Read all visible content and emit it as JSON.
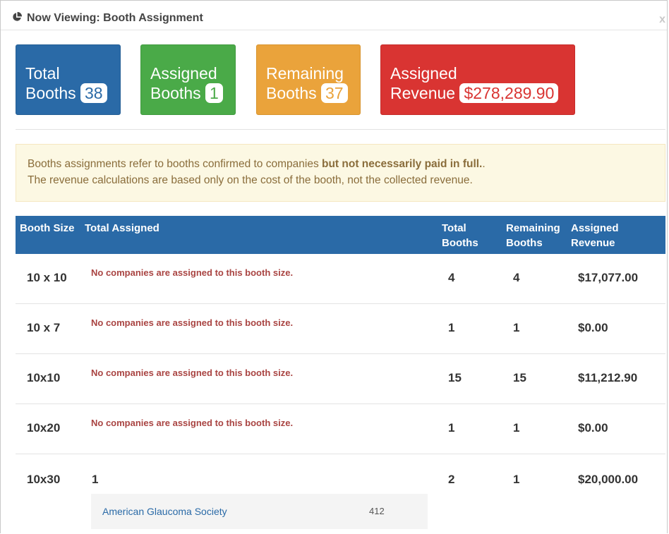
{
  "window": {
    "title": "Now Viewing: Booth Assignment",
    "close_label": "x"
  },
  "stats": {
    "total": {
      "label_line1": "Total",
      "label_line2": "Booths",
      "value": "38"
    },
    "assigned": {
      "label_line1": "Assigned",
      "label_line2": "Booths",
      "value": "1"
    },
    "remaining": {
      "label_line1": "Remaining",
      "label_line2": "Booths",
      "value": "37"
    },
    "revenue": {
      "label_line1": "Assigned",
      "label_line2": "Revenue",
      "value": "$278,289.90"
    }
  },
  "alert": {
    "line1_pre": "Booths assignments refer to booths confirmed to companies ",
    "line1_bold": "but not necessarily paid in full.",
    "line1_post": ".",
    "line2": "The revenue calculations are based only on the cost of the booth, not the collected revenue."
  },
  "table": {
    "headers": {
      "booth_size": "Booth Size",
      "total_assigned": "Total Assigned",
      "total_booths_1": "Total",
      "total_booths_2": "Booths",
      "remaining_booths_1": "Remaining",
      "remaining_booths_2": "Booths",
      "assigned_revenue_1": "Assigned",
      "assigned_revenue_2": "Revenue"
    },
    "rows": [
      {
        "size": "10 x 10",
        "note": "No companies are assigned to this booth size.",
        "total": "4",
        "remaining": "4",
        "revenue": "$17,077.00"
      },
      {
        "size": "10 x 7",
        "note": "No companies are assigned to this booth size.",
        "total": "1",
        "remaining": "1",
        "revenue": "$0.00"
      },
      {
        "size": "10x10",
        "note": "No companies are assigned to this booth size.",
        "total": "15",
        "remaining": "15",
        "revenue": "$11,212.90"
      },
      {
        "size": "10x20",
        "note": "No companies are assigned to this booth size.",
        "total": "1",
        "remaining": "1",
        "revenue": "$0.00"
      },
      {
        "size": "10x30",
        "assigned_count": "1",
        "total": "2",
        "remaining": "1",
        "revenue": "$20,000.00"
      }
    ],
    "assigned_companies": [
      {
        "name": "American Glaucoma Society",
        "booth_number": "412"
      }
    ]
  }
}
